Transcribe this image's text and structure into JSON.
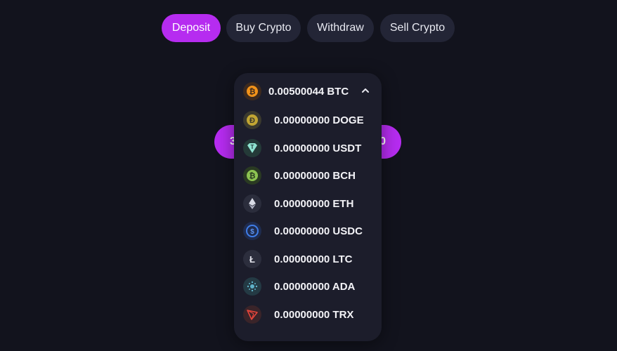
{
  "tabs": [
    {
      "label": "Deposit",
      "active": true
    },
    {
      "label": "Buy Crypto",
      "active": false
    },
    {
      "label": "Withdraw",
      "active": false
    },
    {
      "label": "Sell Crypto",
      "active": false
    }
  ],
  "amount_pill": {
    "left_text": "3",
    "right_text": "0"
  },
  "currency_dropdown": {
    "selected": {
      "balance": "0.00500044 BTC",
      "icon": "bitcoin-icon"
    },
    "expanded": true,
    "options": [
      {
        "balance": "0.00000000 DOGE",
        "icon": "dogecoin-icon"
      },
      {
        "balance": "0.00000000 USDT",
        "icon": "tether-icon"
      },
      {
        "balance": "0.00000000 BCH",
        "icon": "bitcoin-cash-icon"
      },
      {
        "balance": "0.00000000 ETH",
        "icon": "ethereum-icon"
      },
      {
        "balance": "0.00000000 USDC",
        "icon": "usd-coin-icon"
      },
      {
        "balance": "0.00000000 LTC",
        "icon": "litecoin-icon"
      },
      {
        "balance": "0.00000000 ADA",
        "icon": "cardano-icon"
      },
      {
        "balance": "0.00000000 TRX",
        "icon": "tron-icon"
      }
    ]
  },
  "colors": {
    "accent": "#b62cf0",
    "background": "#12131d",
    "tab_inactive": "#232536",
    "dropdown": "#1c1d2b"
  }
}
